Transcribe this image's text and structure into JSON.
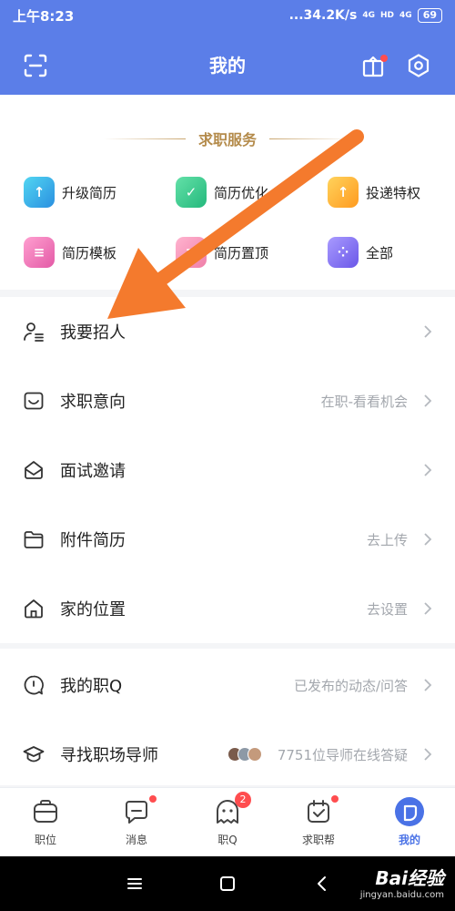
{
  "status_bar": {
    "time": "上午8:23",
    "net_speed": "...34.2K/s",
    "signal_a": "4G",
    "hd": "HD",
    "signal_b": "4G",
    "battery": "69"
  },
  "header": {
    "title": "我的",
    "icons": [
      "scan-icon",
      "gift-icon",
      "settings-icon"
    ],
    "gift_has_dot": true
  },
  "services": {
    "title": "求职服务",
    "items": [
      {
        "label": "升级简历",
        "icon": "upgrade-resume-icon",
        "color": "#2fb6e8"
      },
      {
        "label": "简历优化",
        "icon": "resume-optimize-icon",
        "color": "#35c98c"
      },
      {
        "label": "投递特权",
        "icon": "delivery-privilege-icon",
        "color": "#ffb02e"
      },
      {
        "label": "简历模板",
        "icon": "resume-template-icon",
        "color": "#f06fb0"
      },
      {
        "label": "简历置顶",
        "icon": "resume-top-icon",
        "color": "#f08ab0"
      },
      {
        "label": "全部",
        "icon": "all-icon",
        "color": "#7b6cf0"
      }
    ]
  },
  "menu": [
    {
      "label": "我要招人",
      "hint": "",
      "icon": "recruit-icon"
    },
    {
      "label": "求职意向",
      "hint": "在职-看看机会",
      "icon": "inbox-icon"
    },
    {
      "label": "面试邀请",
      "hint": "",
      "icon": "mail-icon"
    },
    {
      "label": "附件简历",
      "hint": "去上传",
      "icon": "folder-icon"
    },
    {
      "label": "家的位置",
      "hint": "去设置",
      "icon": "home-icon"
    }
  ],
  "menu2": [
    {
      "label": "我的职Q",
      "hint": "已发布的动态/问答",
      "icon": "q-icon"
    },
    {
      "label": "寻找职场导师",
      "hint": "7751位导师在线答疑",
      "icon": "mentor-icon"
    }
  ],
  "tabs": [
    {
      "label": "职位",
      "icon": "briefcase-icon",
      "dot": false,
      "badge": "",
      "active": false
    },
    {
      "label": "消息",
      "icon": "message-icon",
      "dot": true,
      "badge": "",
      "active": false
    },
    {
      "label": "职Q",
      "icon": "zhiq-icon",
      "dot": false,
      "badge": "2",
      "active": false
    },
    {
      "label": "求职帮",
      "icon": "calendar-check-icon",
      "dot": true,
      "badge": "",
      "active": false
    },
    {
      "label": "我的",
      "icon": "profile-icon",
      "dot": false,
      "badge": "",
      "active": true
    }
  ],
  "nav": [
    "menu-icon",
    "home-square-icon",
    "back-icon"
  ],
  "watermark": {
    "brand": "Bai经验",
    "url": "jingyan.baidu.com"
  },
  "colors": {
    "header": "#5b7ee8",
    "accent": "#4a72e6",
    "gold": "#b48b4b",
    "annotation_arrow": "#f47a2d"
  }
}
